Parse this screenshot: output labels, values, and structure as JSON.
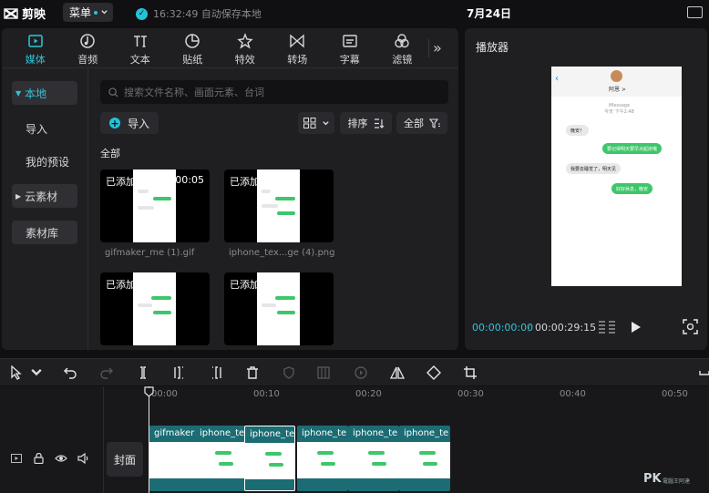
{
  "app": {
    "name": "剪映",
    "menu_label": "菜单",
    "save_status": "16:32:49 自动保存本地",
    "project_title": "7月24日"
  },
  "tabs": [
    {
      "label": "媒体",
      "icon": "media-icon",
      "active": true
    },
    {
      "label": "音频",
      "icon": "audio-icon"
    },
    {
      "label": "文本",
      "icon": "text-icon"
    },
    {
      "label": "贴纸",
      "icon": "sticker-icon"
    },
    {
      "label": "特效",
      "icon": "effects-icon"
    },
    {
      "label": "转场",
      "icon": "transition-icon"
    },
    {
      "label": "字幕",
      "icon": "caption-icon"
    },
    {
      "label": "滤镜",
      "icon": "filter-icon"
    }
  ],
  "sidebar": {
    "items": [
      "本地",
      "导入",
      "我的预设",
      "云素材",
      "素材库"
    ]
  },
  "search": {
    "placeholder": "搜索文件名称、画面元素、台词"
  },
  "toolbar": {
    "import_label": "导入",
    "sort_label": "排序",
    "filter_label": "全部"
  },
  "section": {
    "all_label": "全部"
  },
  "media": [
    {
      "added": "已添加",
      "duration": "00:05",
      "name": "gifmaker_me (1).gif"
    },
    {
      "added": "已添加",
      "duration": "",
      "name": "iphone_tex...ge (4).png"
    },
    {
      "added": "已添加",
      "duration": "",
      "name": ""
    },
    {
      "added": "已添加",
      "duration": "",
      "name": ""
    }
  ],
  "player": {
    "title": "播放器",
    "current_time": "00:00:00:00",
    "separator": "/",
    "total_time": "00:00:29:15",
    "preview": {
      "contact": "阿恩 >",
      "timestamp_line1": "iMessage",
      "timestamp_line2": "今天 下午2:48",
      "bubbles": [
        {
          "side": "w",
          "text": "晚安！"
        },
        {
          "side": "g",
          "text": "要记得明天要早点起床哦"
        },
        {
          "side": "w",
          "text": "我要去睡觉了，明天见"
        },
        {
          "side": "g",
          "text": "好好休息，晚安"
        }
      ]
    }
  },
  "timeline": {
    "ticks": [
      "00:00",
      "00:10",
      "00:20",
      "00:30",
      "00:40",
      "00:50"
    ],
    "cover_label": "封面",
    "clips": [
      "gifmaker",
      "iphone_te",
      "iphone_te",
      "iphone_te",
      "iphone_te",
      "iphone_te"
    ]
  },
  "watermark": {
    "text": "PK",
    "sub": "電腦王阿達"
  },
  "colors": {
    "accent": "#2fc5d9",
    "clip": "#1b6c73",
    "bubble_green": "#3ec66b"
  }
}
